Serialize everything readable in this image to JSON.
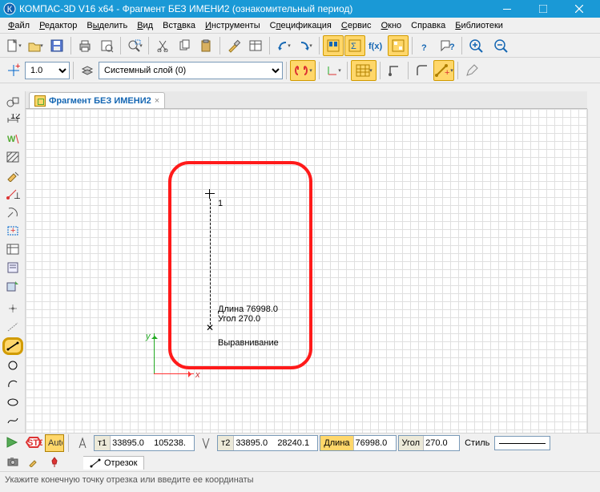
{
  "title": "КОМПАС-3D V16  x64 - Фрагмент БЕЗ ИМЕНИ2 (ознакомительный период)",
  "menu": [
    "Файл",
    "Редактор",
    "Выделить",
    "Вид",
    "Вставка",
    "Инструменты",
    "Спецификация",
    "Сервис",
    "Окно",
    "Справка",
    "Библиотеки"
  ],
  "toolbar2": {
    "zoom_value": "1.0",
    "layer_value": "Системный слой (0)"
  },
  "doc_tab": "Фрагмент БЕЗ ИМЕНИ2",
  "canvas": {
    "point1_label": "1",
    "length_label": "Длина 76998.0",
    "angle_label": "Угол 270.0",
    "align_label": "Выравнивание",
    "x_axis": "x",
    "y_axis": "y"
  },
  "props": {
    "t1_label": "т1",
    "t1_x": "33895.0",
    "t1_y": "105238.",
    "t2_label": "т2",
    "t2_x": "33895.0",
    "t2_y": "28240.1",
    "length_label": "Длина",
    "length_val": "76998.0",
    "angle_label": "Угол",
    "angle_val": "270.0",
    "style_label": "Стиль",
    "tab_name": "Отрезок"
  },
  "status": "Укажите конечную точку отрезка или введите ее координаты"
}
